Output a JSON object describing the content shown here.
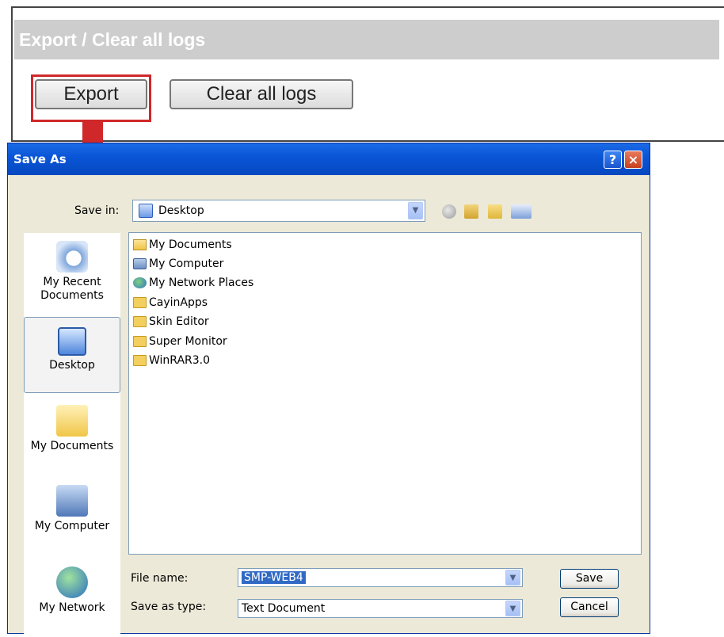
{
  "web_panel": {
    "header": "Export / Clear all logs",
    "export_button": "Export",
    "clear_button": "Clear all logs"
  },
  "dialog": {
    "title": "Save As",
    "help_button": "?",
    "close_button": "×",
    "save_in_label": "Save in:",
    "save_in_value": "Desktop",
    "places": [
      {
        "label": "My Recent Documents",
        "icon": "recent-documents-icon"
      },
      {
        "label": "Desktop",
        "icon": "desktop-icon"
      },
      {
        "label": "My Documents",
        "icon": "my-documents-icon"
      },
      {
        "label": "My Computer",
        "icon": "my-computer-icon"
      },
      {
        "label": "My Network",
        "icon": "my-network-icon"
      }
    ],
    "files": [
      {
        "name": "My Documents",
        "icon": "my-documents-icon"
      },
      {
        "name": "My Computer",
        "icon": "my-computer-icon"
      },
      {
        "name": "My Network Places",
        "icon": "network-places-icon"
      },
      {
        "name": "CayinApps",
        "icon": "folder-icon"
      },
      {
        "name": "Skin Editor",
        "icon": "folder-icon"
      },
      {
        "name": "Super Monitor",
        "icon": "folder-icon"
      },
      {
        "name": "WinRAR3.0",
        "icon": "folder-icon"
      }
    ],
    "file_name_label": "File name:",
    "file_name_value": "SMP-WEB4",
    "save_type_label": "Save as type:",
    "save_type_value": "Text Document",
    "save_button": "Save",
    "cancel_button": "Cancel"
  },
  "colors": {
    "highlight_red": "#d0282a",
    "titlebar_blue": "#0a56d8",
    "dialog_bg": "#ece9d8"
  }
}
